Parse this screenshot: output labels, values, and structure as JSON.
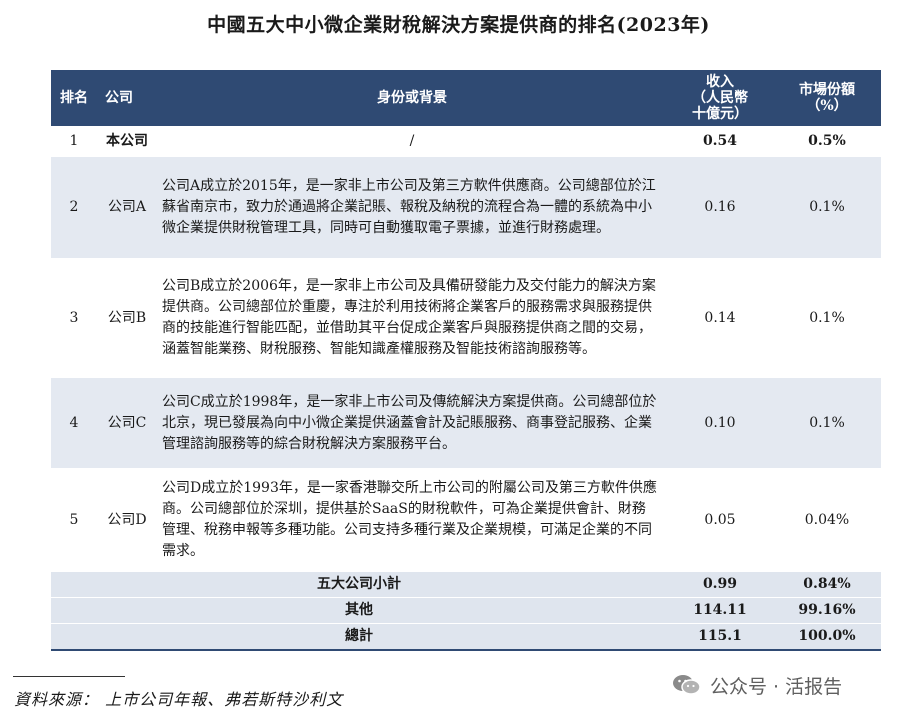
{
  "title": "中國五大中小微企業財稅解決方案提供商的排名(2023年)",
  "table": {
    "headers": {
      "rank": "排名",
      "company": "公司",
      "background": "身份或背景",
      "revenue": "收入\n（人民幣\n十億元）",
      "share": "市場份額\n（%）"
    },
    "rows": [
      {
        "rank": "1",
        "company": "本公司",
        "background": "/",
        "revenue": "0.54",
        "share": "0.5%"
      },
      {
        "rank": "2",
        "company": "公司A",
        "background": "公司A成立於2015年，是一家非上市公司及第三方軟件供應商。公司總部位於江蘇省南京市，致力於通過將企業記賬、報稅及納稅的流程合為一體的系統為中小微企業提供財稅管理工具，同時可自動獲取電子票據，並進行財務處理。",
        "revenue": "0.16",
        "share": "0.1%"
      },
      {
        "rank": "3",
        "company": "公司B",
        "background": "公司B成立於2006年，是一家非上市公司及具備研發能力及交付能力的解決方案提供商。公司總部位於重慶，專注於利用技術將企業客戶的服務需求與服務提供商的技能進行智能匹配，並借助其平台促成企業客戶與服務提供商之間的交易，涵蓋智能業務、財稅服務、智能知識產權服務及智能技術諮詢服務等。",
        "revenue": "0.14",
        "share": "0.1%"
      },
      {
        "rank": "4",
        "company": "公司C",
        "background": "公司C成立於1998年，是一家非上市公司及傳統解決方案提供商。公司總部位於北京，現已發展為向中小微企業提供涵蓋會計及記賬服務、商事登記服務、企業管理諮詢服務等的綜合財稅解決方案服務平台。",
        "revenue": "0.10",
        "share": "0.1%"
      },
      {
        "rank": "5",
        "company": "公司D",
        "background": "公司D成立於1993年，是一家香港聯交所上市公司的附屬公司及第三方軟件供應商。公司總部位於深圳，提供基於SaaS的財稅軟件，可為企業提供會計、財務管理、稅務申報等多種功能。公司支持多種行業及企業規模，可滿足企業的不同需求。",
        "revenue": "0.05",
        "share": "0.04%"
      }
    ],
    "summary": [
      {
        "label": "五大公司小計",
        "revenue": "0.99",
        "share": "0.84%"
      },
      {
        "label": "其他",
        "revenue": "114.11",
        "share": "99.16%"
      },
      {
        "label": "總計",
        "revenue": "115.1",
        "share": "100.0%"
      }
    ]
  },
  "source": "資料來源： 上市公司年報、弗若斯特沙利文",
  "watermark": "公众号 · 活报告",
  "colors": {
    "header_bg": "#2f4a73",
    "shade_bg": "#e4e9f1"
  }
}
